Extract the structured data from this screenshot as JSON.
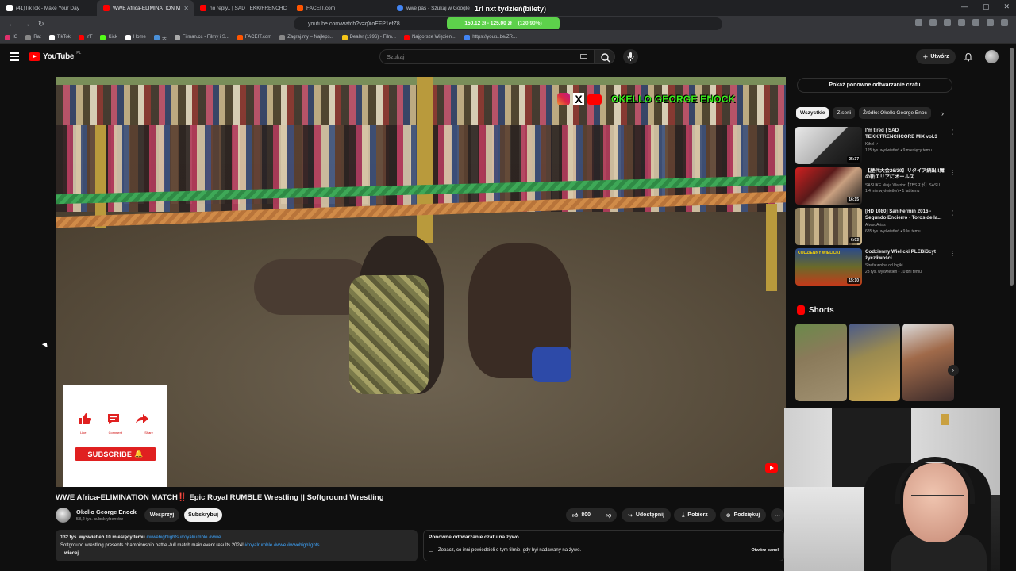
{
  "browser": {
    "tabs": [
      {
        "label": "(41)TikTok - Make Your Day",
        "active": false,
        "color": "#ffffff"
      },
      {
        "label": "WWE Africa-ELIMINATION M",
        "active": true,
        "color": "#ff0000"
      },
      {
        "label": "no reply.. | SAD TEKK/FRENCHC",
        "active": false,
        "color": "#ff0000"
      },
      {
        "label": "FACEIT.com",
        "active": false,
        "color": "#ff5500"
      },
      {
        "label": "wwe pas - Szukaj w Google",
        "active": false,
        "color": "#4285f4"
      }
    ],
    "url": "youtube.com/watch?v=qXoEFP1efZ8",
    "bookmarks": [
      {
        "label": "IG",
        "color": "#e1306c"
      },
      {
        "label": "Rat",
        "color": "#888888"
      },
      {
        "label": "TikTok",
        "color": "#ffffff"
      },
      {
        "label": "YT",
        "color": "#ff0000"
      },
      {
        "label": "Kick",
        "color": "#53fc18"
      },
      {
        "label": "Home",
        "color": "#ffffff"
      },
      {
        "label": "天",
        "color": "#4a90d9"
      },
      {
        "label": "Filman.cc - Filmy i S...",
        "color": "#aaaaaa"
      },
      {
        "label": "FACEIT.com",
        "color": "#ff5500"
      },
      {
        "label": "Zagraj.my – Najleps...",
        "color": "#888888"
      },
      {
        "label": "Dealer (1996) - Film...",
        "color": "#f5c518"
      },
      {
        "label": "Najgorsze Więzieni...",
        "color": "#ff0000"
      },
      {
        "label": "https://youtu.be/ZR...",
        "color": "#4285f4"
      }
    ]
  },
  "stream_overlay": {
    "title": "1rl nxt tydzień(bilety)",
    "progress_text": "150,12 zł - 125,00 zł",
    "progress_pct": "(120.90%)",
    "bar_color": "#5dd14b"
  },
  "youtube": {
    "logo": "YouTube",
    "logo_country": "PL",
    "search_placeholder": "Szukaj",
    "create_label": "Utwórz"
  },
  "video": {
    "credit": "OKELLO GEORGE ENOCK",
    "overlay": {
      "like": "Like",
      "comment": "Comment",
      "share": "Share",
      "subscribe": "SUBSCRIBE"
    },
    "title": "WWE Africa-ELIMINATION MATCH‼️ Epic Royal RUMBLE Wrestling || Softground Wrestling",
    "channel": "Okello George Enock",
    "subscribers": "58,2 tys. subskrybentów",
    "support_label": "Wesprzyj",
    "subscribe_label": "Subskrybuj",
    "likes": "800",
    "share_label": "Udostępnij",
    "download_label": "Pobierz",
    "thanks_label": "Podziękuj"
  },
  "description": {
    "meta": "132 tys. wyświetleń  10 miesięcy temu",
    "tags": "#wwehighlights #royalrumble #wwe",
    "line2": "Softground wrestling presents championship battle -full match main event results 2024! ",
    "line2_tags": "#royalrumble #wwe #wwehighlights",
    "more": "...więcej"
  },
  "chat": {
    "title": "Ponowne odtwarzanie czatu na żywo",
    "desc": "Zobacz, co inni powiedzieli o tym filmie, gdy był nadawany na żywo.",
    "open": "Otwórz panel"
  },
  "sidebar": {
    "replay": "Pokaż ponowne odtwarzanie czatu",
    "chips": [
      "Wszystkie",
      "Z serii",
      "Źródło: Okello George Enoc"
    ],
    "recommendations": [
      {
        "title": "I'm tired | SAD TEKK/FRENCHCORE MIX vol.3",
        "channel": "Kthel ✓",
        "meta": "125 tys. wyświetleń • 9 miesięcy temu",
        "duration": "25:37"
      },
      {
        "title": "【歴代大会26/39】リタイア続出‼魔の新エリアにオールス...",
        "channel": "SASUKE Ninja Warrior【TBSスポ】SASU...",
        "meta": "1,4 mln wyświetleń • 1 lat temu",
        "duration": "16:15"
      },
      {
        "title": "[HD 1080] San Fermin 2016 - Segundo Encierro - Toros de la...",
        "channel": "AlvaroArias",
        "meta": "685 tys. wyświetleń • 9 lat temu",
        "duration": "6:03"
      },
      {
        "title": "Codzienny Wielicki PLEBiScyt życzliwości",
        "channel": "Strefa wolna od logiki",
        "meta": "23 tys. wyświetleń • 10 dni temu",
        "duration": "15:10",
        "thumb_label": "CODZIENNY WIELICKI"
      }
    ],
    "shorts_title": "Shorts"
  }
}
